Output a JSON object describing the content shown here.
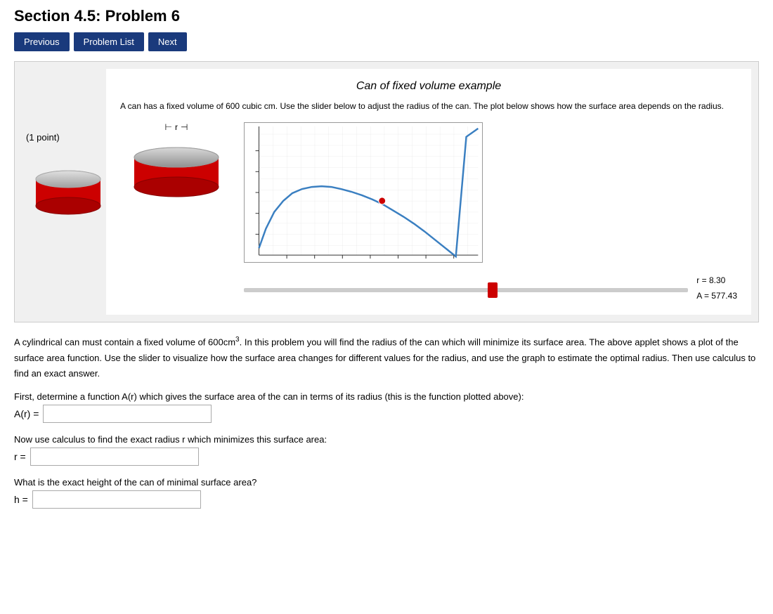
{
  "page": {
    "title": "Section 4.5: Problem 6",
    "nav": {
      "previous_label": "Previous",
      "problem_list_label": "Problem List",
      "next_label": "Next"
    }
  },
  "interactive": {
    "title": "Can of fixed volume example",
    "description": "A can has a fixed volume of 600 cubic cm. Use the slider below to adjust the radius of the can. The plot below shows how the surface area depends on the radius.",
    "radius_label": "r",
    "slider_r": 8.3,
    "display_r": "r = 8.30",
    "display_A": "A = 577.43"
  },
  "problem": {
    "text_intro": "A cylindrical can must contain a fixed volume of 600cm",
    "text_sup": "3",
    "text_cont": ". In this problem you will find the radius of the can which will minimize its surface area. The above applet shows a plot of the surface area function. Use the slider to visualize how the surface area changes for different values for the radius, and use the graph to estimate the optimal radius. Then use calculus to find an exact answer.",
    "q1_label": "First, determine a function A(r) which gives the surface area of the can in terms of its radius (this is the function plotted above):",
    "q1_answer_prefix": "A(r) =",
    "q1_placeholder": "",
    "q2_label": "Now use calculus to find the exact radius r which minimizes this surface area:",
    "q2_answer_prefix": "r =",
    "q2_placeholder": "",
    "q3_label": "What is the exact height of the can of minimal surface area?",
    "q3_answer_prefix": "h =",
    "q3_placeholder": ""
  },
  "icons": {
    "arrow_left": "←",
    "arrow_right": "→"
  }
}
